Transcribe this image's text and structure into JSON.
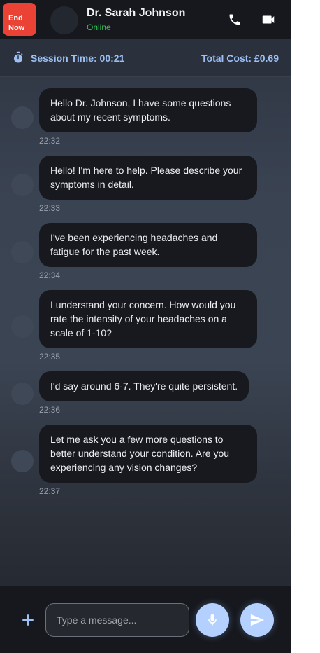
{
  "header": {
    "end_label": "End Now",
    "doctor_name": "Dr. Sarah Johnson",
    "status": "Online",
    "phone_icon": "phone-icon",
    "video_icon": "video-camera-icon"
  },
  "session": {
    "time_label": "Session Time: 00:21",
    "cost_label": "Total Cost: £0.69",
    "timer_icon": "stopwatch-icon"
  },
  "messages": [
    {
      "text": "Hello Dr. Johnson, I have some questions about my recent symptoms.",
      "time": "22:32"
    },
    {
      "text": "Hello! I'm here to help. Please describe your symptoms in detail.",
      "time": "22:33"
    },
    {
      "text": "I've been experiencing headaches and fatigue for the past week.",
      "time": "22:34"
    },
    {
      "text": "I understand your concern. How would you rate the intensity of your headaches on a scale of 1-10?",
      "time": "22:35"
    },
    {
      "text": "I'd say around 6-7. They're quite persistent.",
      "time": "22:36"
    },
    {
      "text": "Let me ask you a few more questions to better understand your condition. Are you experiencing any vision changes?",
      "time": "22:37"
    }
  ],
  "composer": {
    "placeholder": "Type a message...",
    "value": "",
    "plus_icon": "plus-icon",
    "mic_icon": "microphone-icon",
    "send_icon": "send-icon"
  },
  "colors": {
    "end_button": "#ea4335",
    "online": "#34c759",
    "accent": "#9cc0f5",
    "action_button": "#b3d0ff",
    "bubble": "#17191e"
  }
}
